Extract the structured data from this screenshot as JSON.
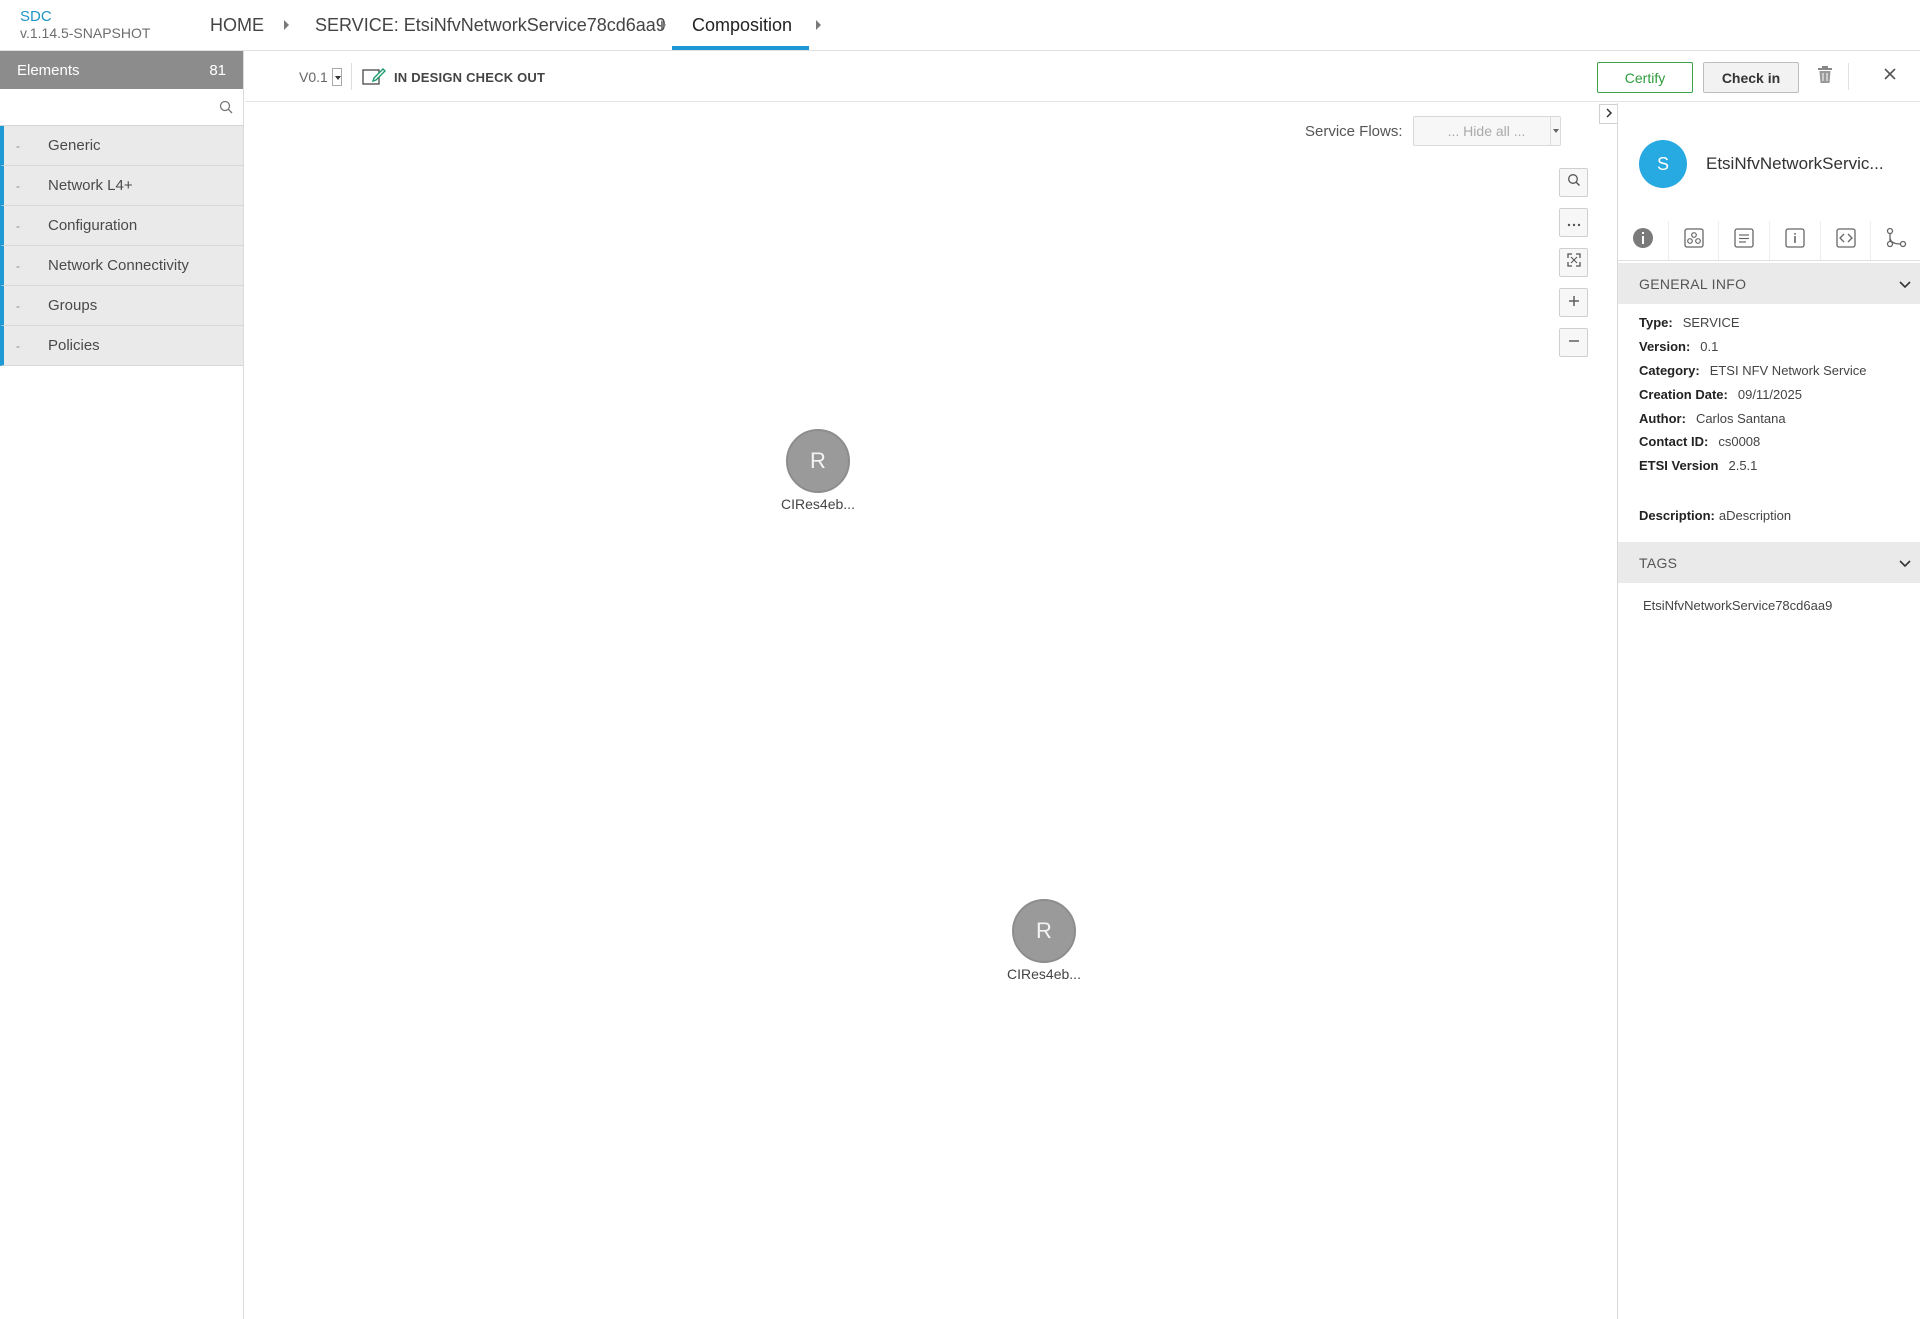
{
  "app": {
    "name": "SDC",
    "version": "v.1.14.5-SNAPSHOT"
  },
  "breadcrumb": {
    "home": "HOME",
    "service": "SERVICE: EtsiNfvNetworkService78cd6aa9",
    "composition": "Composition"
  },
  "palette": {
    "title": "Elements",
    "count": "81",
    "search_placeholder": "",
    "groups": [
      {
        "label": "Generic"
      },
      {
        "label": "Network L4+"
      },
      {
        "label": "Configuration"
      },
      {
        "label": "Network Connectivity"
      },
      {
        "label": "Groups"
      },
      {
        "label": "Policies"
      }
    ]
  },
  "workspace": {
    "version": "V0.1",
    "status": "IN DESIGN CHECK OUT",
    "certify_label": "Certify",
    "checkin_label": "Check in"
  },
  "canvas": {
    "service_flows_label": "Service Flows:",
    "service_flows_value": "... Hide all ...",
    "nodes": [
      {
        "letter": "R",
        "label": "CIRes4eb..."
      },
      {
        "letter": "R",
        "label": "CIRes4eb..."
      }
    ]
  },
  "details": {
    "avatar_letter": "S",
    "title": "EtsiNfvNetworkServic...",
    "general_info_title": "GENERAL INFO",
    "rows": [
      {
        "key": "Type:",
        "value": "SERVICE"
      },
      {
        "key": "Version:",
        "value": "0.1"
      },
      {
        "key": "Category:",
        "value": "ETSI NFV Network Service"
      },
      {
        "key": "Creation Date:",
        "value": "09/11/2025"
      },
      {
        "key": "Author:",
        "value": "Carlos Santana"
      },
      {
        "key": "Contact ID:",
        "value": "cs0008"
      },
      {
        "key": "ETSI Version",
        "value": "2.5.1"
      }
    ],
    "description_key": "Description:",
    "description_value": "aDescription",
    "tags_title": "TAGS",
    "tags_value": "EtsiNfvNetworkService78cd6aa9"
  },
  "colors": {
    "accent": "#1d9ad6",
    "certify": "#3ea34a",
    "avatar": "#27a9e1",
    "node": "#9a9a9a"
  }
}
